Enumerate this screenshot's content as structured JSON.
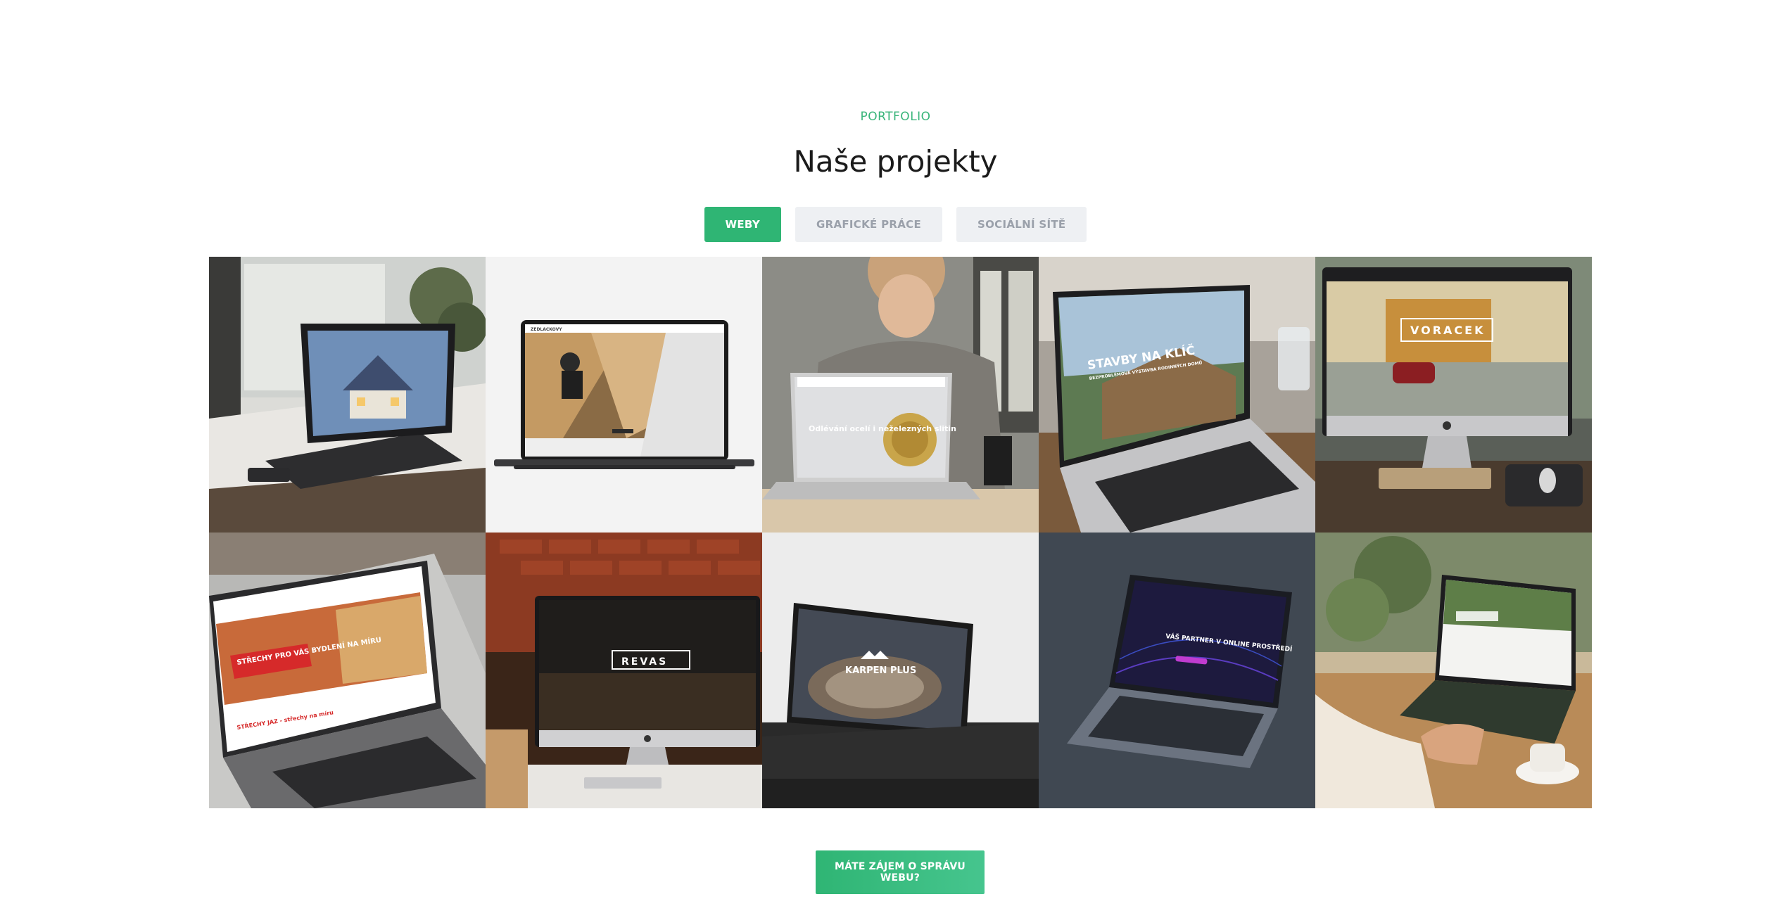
{
  "section": {
    "eyebrow": "PORTFOLIO",
    "title": "Naše projekty"
  },
  "filters": [
    {
      "label": "WEBY",
      "active": true
    },
    {
      "label": "GRAFICKÉ PRÁCE",
      "active": false
    },
    {
      "label": "SOCIÁLNÍ SÍTĚ",
      "active": false
    }
  ],
  "projects": [
    {
      "id": "house-laptop"
    },
    {
      "id": "roof-macbook",
      "screen_text": "ZEDLACKOVY"
    },
    {
      "id": "casting-laptop",
      "screen_text": "Odlévání ocelí i neželezných slitin"
    },
    {
      "id": "stavby-laptop",
      "screen_text": "STAVBY NA KLÍČ",
      "screen_subtext": "BEZPROBLÉMOVÁ VÝSTAVBA RODINNÝCH DOMŮ"
    },
    {
      "id": "voracek-imac",
      "screen_text": "VORACEK"
    },
    {
      "id": "strechy-laptop",
      "screen_text": "STŘECHY PRO VÁS BYDLENÍ NA MÍRU",
      "screen_subtext": "STŘECHY JAZ - střechy na míru"
    },
    {
      "id": "revas-imac",
      "screen_text": "REVAS"
    },
    {
      "id": "karpen-laptop",
      "screen_text": "KARPEN PLUS"
    },
    {
      "id": "partner-laptop",
      "screen_text": "VÁŠ PARTNER V ONLINE PROSTŘEDÍ"
    },
    {
      "id": "forest-laptop"
    }
  ],
  "cta": {
    "label": "MÁTE ZÁJEM O SPRÁVU WEBU?"
  },
  "colors": {
    "accent": "#2fb574",
    "inactive_bg": "#eef0f3",
    "inactive_text": "#9aa0aa",
    "title": "#1b1b1b"
  }
}
